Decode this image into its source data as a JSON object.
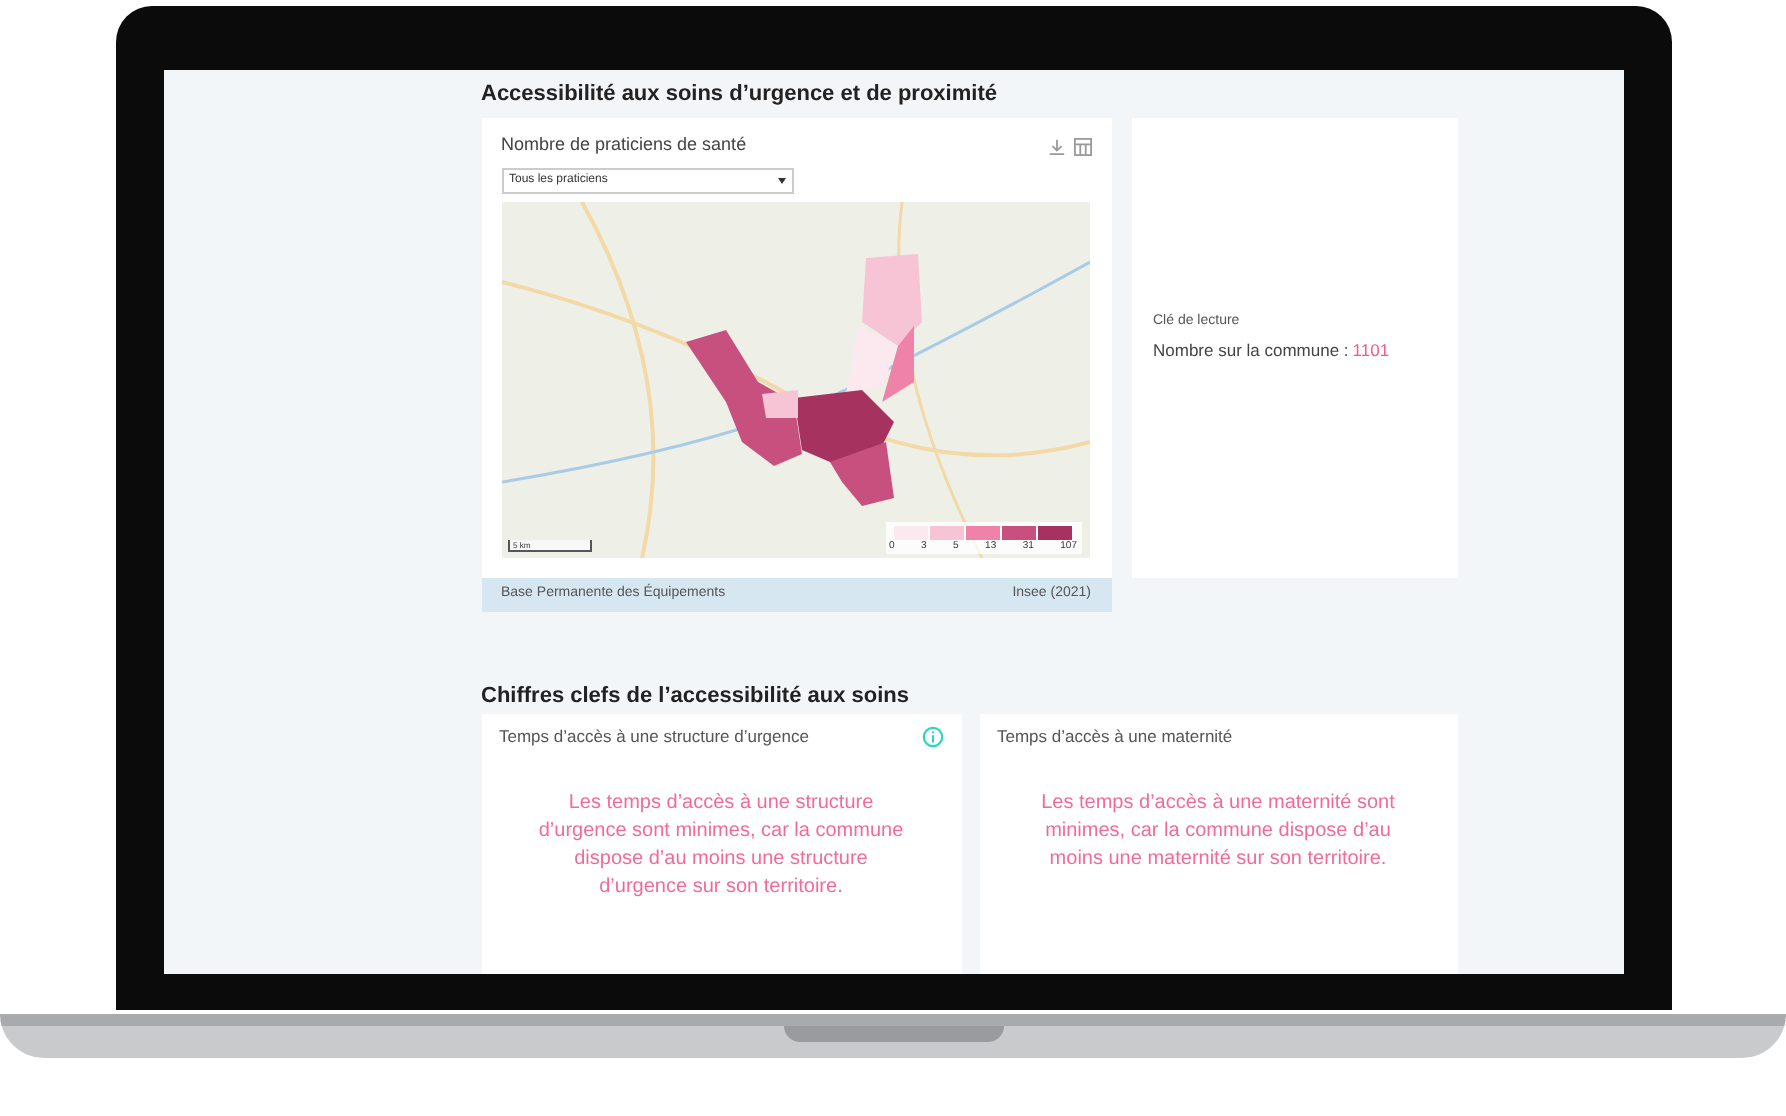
{
  "section_1": {
    "title": "Accessibilité aux soins d’urgence et de proximité",
    "map_card": {
      "title": "Nombre de praticiens de santé",
      "select": {
        "value": "Tous les praticiens"
      },
      "legend": {
        "bins": [
          {
            "color": "#fce9f0"
          },
          {
            "color": "#f7c4d6"
          },
          {
            "color": "#ef82a8"
          },
          {
            "color": "#c8507f"
          },
          {
            "color": "#a6335f"
          }
        ],
        "ticks": [
          "0",
          "3",
          "5",
          "13",
          "31",
          "107"
        ]
      },
      "scale": "5 km",
      "source": "Base Permanente des Équipements",
      "credit": "Insee (2021)"
    },
    "reading_card": {
      "heading": "Clé de lecture",
      "label": "Nombre sur la commune :",
      "value": "1101"
    }
  },
  "section_2": {
    "title": "Chiffres clefs de l’accessibilité aux soins",
    "cards": [
      {
        "title": "Temps d’accès à une structure d’urgence",
        "info": true,
        "message": "Les temps d’accès à une structure d’urgence sont minimes, car la commune dispose d’au moins une structure d’urgence sur son territoire."
      },
      {
        "title": "Temps d’accès à une maternité",
        "info": false,
        "message": "Les temps d’accès à une maternité sont minimes, car la commune dispose d’au moins une maternité sur son territoire."
      }
    ]
  }
}
